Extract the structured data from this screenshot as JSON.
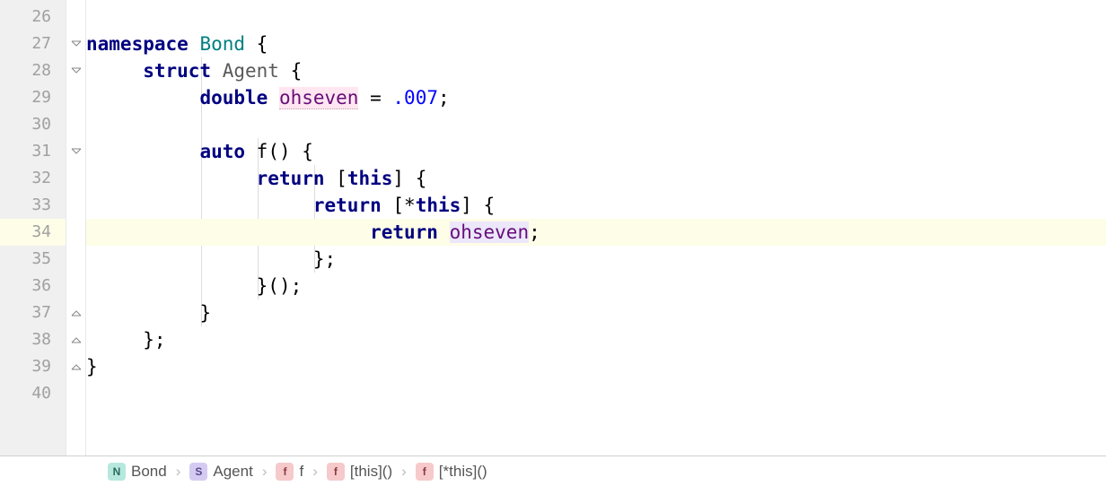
{
  "gutter": {
    "start": 26,
    "count": 15,
    "highlighted_line": 34
  },
  "code": {
    "l27": {
      "kw1": "namespace",
      "name": "Bond",
      "open": " {"
    },
    "l28": {
      "kw1": "struct",
      "name": "Agent",
      "open": " {"
    },
    "l29": {
      "kw1": "double",
      "ident": "ohseven",
      "eq": " = ",
      "val": ".007",
      "semi": ";"
    },
    "l31": {
      "kw1": "auto",
      "fn": "f",
      "sig": "() {"
    },
    "l32": {
      "kw1": "return",
      "cap": "[",
      "kw2": "this",
      "close": "] {"
    },
    "l33": {
      "kw1": "return",
      "cap": "[*",
      "kw2": "this",
      "close": "] {"
    },
    "l34": {
      "kw1": "return",
      "ident": "ohseven",
      "semi": ";"
    },
    "l35": {
      "txt": "};"
    },
    "l36": {
      "txt": "}();"
    },
    "l37": {
      "txt": "}"
    },
    "l38": {
      "txt": "};"
    },
    "l39": {
      "txt": "}"
    }
  },
  "breadcrumb": {
    "items": [
      {
        "badge": "N",
        "badge_class": "badge-n",
        "label": "Bond"
      },
      {
        "badge": "S",
        "badge_class": "badge-s",
        "label": "Agent"
      },
      {
        "badge": "f",
        "badge_class": "badge-f",
        "label": "f"
      },
      {
        "badge": "f",
        "badge_class": "badge-f",
        "label": "[this]()"
      },
      {
        "badge": "f",
        "badge_class": "badge-f",
        "label": "[*this]()"
      }
    ],
    "sep": "›"
  }
}
